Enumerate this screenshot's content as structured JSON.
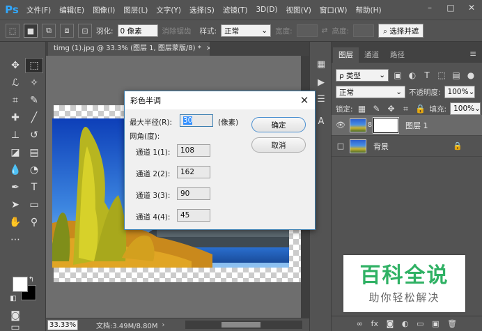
{
  "app": {
    "logo": "Ps"
  },
  "menu": [
    "文件(F)",
    "编辑(E)",
    "图像(I)",
    "图层(L)",
    "文字(Y)",
    "选择(S)",
    "滤镜(T)",
    "3D(D)",
    "视图(V)",
    "窗口(W)",
    "帮助(H)"
  ],
  "window_controls": {
    "minimize": "–",
    "maximize": "□",
    "close": "✕"
  },
  "options": {
    "feather_label": "羽化:",
    "feather_value": "0 像素",
    "antialias_label": "消除锯齿",
    "style_label": "样式:",
    "style_value": "正常",
    "width_label": "宽度:",
    "height_label": "高度:",
    "select_mask_label": "选择并遮"
  },
  "document": {
    "tab_title": "timg (1).jpg @ 33.3% (图层 1, 图层蒙版/8) *",
    "tab_close": "×"
  },
  "status": {
    "zoom": "33.33%",
    "doc_info": "文档:3.49M/8.80M",
    "arrow": "›"
  },
  "layers_panel": {
    "tabs": [
      "图层",
      "通道",
      "路径"
    ],
    "filter_label": "ρ 类型",
    "blend_mode": "正常",
    "opacity_label": "不透明度:",
    "opacity_value": "100%",
    "lock_label": "锁定:",
    "fill_label": "填充:",
    "fill_value": "100%",
    "layers": [
      {
        "name": "图层 1",
        "selected": true
      },
      {
        "name": "背景",
        "selected": false
      }
    ],
    "bottom_icons": [
      "∞",
      "fx",
      "◙",
      "◐",
      "▭",
      "▣",
      "🗑"
    ]
  },
  "dialog": {
    "title": "彩色半调",
    "max_radius_label": "最大半径(R):",
    "max_radius_value": "30",
    "unit": "(像素)",
    "angle_label": "网角(度):",
    "channels": [
      {
        "label": "通道 1(1):",
        "value": "108"
      },
      {
        "label": "通道 2(2):",
        "value": "162"
      },
      {
        "label": "通道 3(3):",
        "value": "90"
      },
      {
        "label": "通道 4(4):",
        "value": "45"
      }
    ],
    "ok_label": "确定",
    "cancel_label": "取消",
    "close": "✕"
  },
  "watermark": {
    "title": "百科全说",
    "subtitle": "助你轻松解决"
  },
  "colors": {
    "accent": "#31a8ff",
    "ui_bg": "#535353",
    "watermark_green": "#2fb164"
  }
}
